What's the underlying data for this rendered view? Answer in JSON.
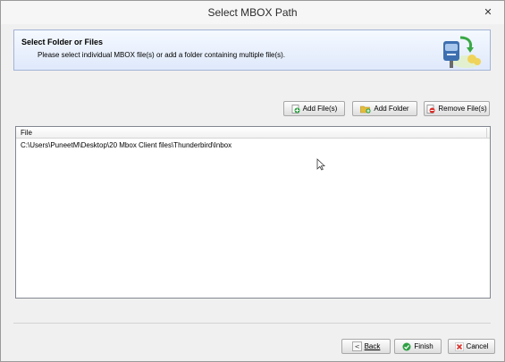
{
  "window": {
    "title": "Select MBOX Path",
    "close_glyph": "✕"
  },
  "header": {
    "title": "Select Folder or Files",
    "description": "Please select individual MBOX file(s) or add a folder containing multiple file(s).",
    "icon": "mailbox-arrow-icon"
  },
  "toolbar": {
    "add_files_label": "Add File(s)",
    "add_folder_label": "Add Folder",
    "remove_files_label": "Remove File(s)"
  },
  "file_list": {
    "columns": [
      "File"
    ],
    "rows": [
      {
        "path": "C:\\Users\\PuneetM\\Desktop\\20 Mbox Client files\\Thunderbird\\Inbox"
      }
    ]
  },
  "footer": {
    "back_label": "Back",
    "back_glyph": "<",
    "finish_label": "Finish",
    "cancel_label": "Cancel"
  },
  "colors": {
    "header_border": "#a3b4d6",
    "add_icon": "#2ea043",
    "remove_icon": "#d9302b",
    "folder_icon": "#e4bc3a"
  }
}
